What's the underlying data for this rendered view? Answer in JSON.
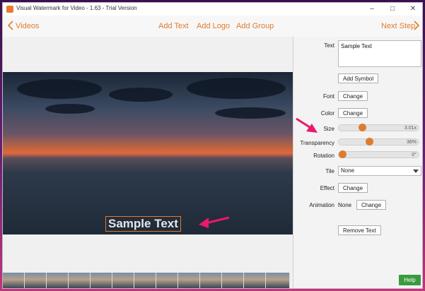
{
  "window": {
    "title": "Visual Watermark for Video - 1.63 - Trial Version",
    "controls": {
      "minimize": "–",
      "maximize": "□",
      "close": "✕"
    }
  },
  "toolbar": {
    "back_label": "Videos",
    "add_text": "Add Text",
    "add_logo": "Add Logo",
    "add_group": "Add Group",
    "next_label": "Next Step"
  },
  "preview": {
    "watermark_text": "Sample Text"
  },
  "panel": {
    "text_label": "Text",
    "text_value": "Sample Text",
    "add_symbol": "Add Symbol",
    "font_label": "Font",
    "font_button": "Change",
    "color_label": "Color",
    "color_button": "Change",
    "size_label": "Size",
    "size_value": "3.01x",
    "transparency_label": "Transparency",
    "transparency_value": "36%",
    "rotation_label": "Rotation",
    "rotation_value": "0°",
    "tile_label": "Tile",
    "tile_value": "None",
    "effect_label": "Effect",
    "effect_button": "Change",
    "animation_label": "Animation",
    "animation_value": "None",
    "animation_button": "Change",
    "remove_button": "Remove Text"
  },
  "help_label": "Help",
  "colors": {
    "accent": "#e07b2c",
    "help": "#3a9a3f",
    "annotation_arrow": "#e8196b"
  }
}
